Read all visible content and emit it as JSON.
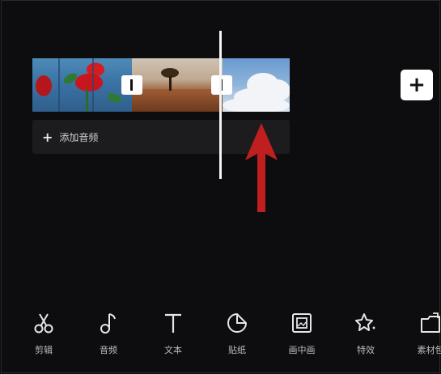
{
  "timeline": {
    "add_audio_plus": "+",
    "add_audio_label": "添加音频",
    "add_clip_symbol": "+"
  },
  "annotation": {
    "arrow_color": "#c01f1f"
  },
  "toolbar": {
    "items": [
      {
        "label": "剪辑",
        "icon": "scissors-icon"
      },
      {
        "label": "音频",
        "icon": "music-note-icon"
      },
      {
        "label": "文本",
        "icon": "text-icon"
      },
      {
        "label": "贴纸",
        "icon": "sticker-icon"
      },
      {
        "label": "画中画",
        "icon": "picture-in-picture-icon"
      },
      {
        "label": "特效",
        "icon": "effects-star-icon"
      },
      {
        "label": "素材包",
        "icon": "material-pack-icon"
      }
    ]
  }
}
